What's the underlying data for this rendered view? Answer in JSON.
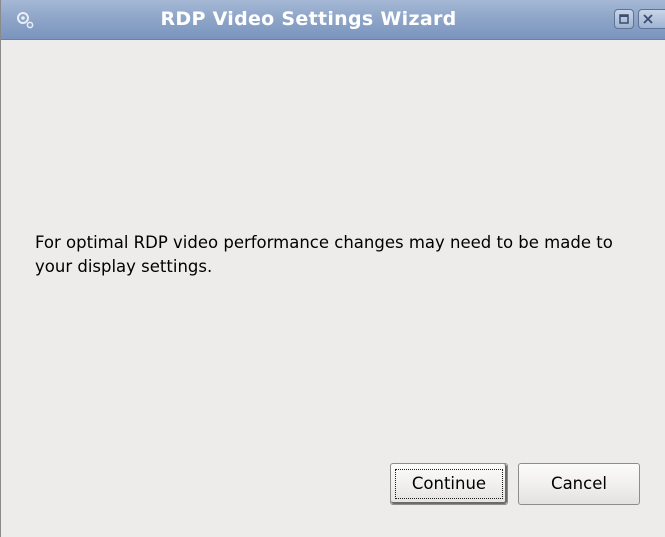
{
  "window": {
    "title": "RDP Video Settings Wizard",
    "icon": "gear-icon"
  },
  "titlebar_buttons": {
    "maximize_icon": "maximize-icon",
    "close_icon": "close-icon"
  },
  "content": {
    "message": "For optimal RDP video performance changes may need to be made to your display settings."
  },
  "buttons": {
    "continue_label": "Continue",
    "cancel_label": "Cancel"
  },
  "colors": {
    "titlebar": "#8fa6c9",
    "background": "#edeceb",
    "title_text": "#ffffff"
  }
}
